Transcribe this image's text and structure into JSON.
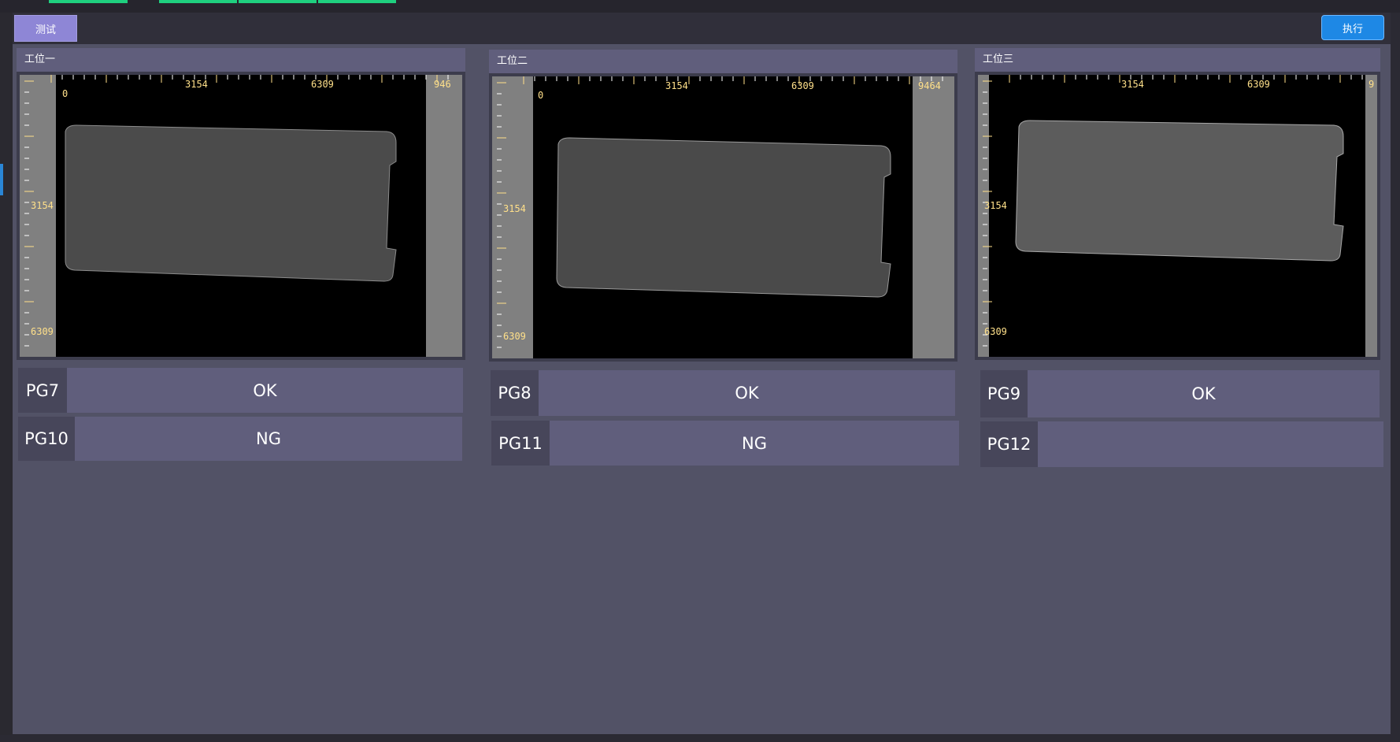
{
  "toolbar": {
    "test_label": "测试",
    "exec_label": "执行"
  },
  "stations": [
    {
      "title": "工位一",
      "ruler": {
        "x_ticks": [
          "0",
          "3154",
          "6309",
          "946"
        ],
        "y_ticks": [
          "3154",
          "6309"
        ]
      },
      "pg_rows": [
        {
          "label": "PG7",
          "value": "OK"
        },
        {
          "label": "PG10",
          "value": "NG"
        }
      ]
    },
    {
      "title": "工位二",
      "ruler": {
        "x_ticks": [
          "0",
          "3154",
          "6309",
          "9464"
        ],
        "y_ticks": [
          "3154",
          "6309"
        ]
      },
      "pg_rows": [
        {
          "label": "PG8",
          "value": "OK"
        },
        {
          "label": "PG11",
          "value": "NG"
        }
      ]
    },
    {
      "title": "工位三",
      "ruler": {
        "x_ticks": [
          "3154",
          "6309",
          "9"
        ],
        "y_ticks": [
          "3154",
          "6309"
        ]
      },
      "pg_rows": [
        {
          "label": "PG9",
          "value": "OK"
        },
        {
          "label": "PG12",
          "value": ""
        }
      ]
    }
  ],
  "colors": {
    "accent_button": "#8e86d6",
    "exec_button": "#1e88e5",
    "status_indicator": "#1fd07f",
    "ruler_text": "#ffe08a"
  }
}
